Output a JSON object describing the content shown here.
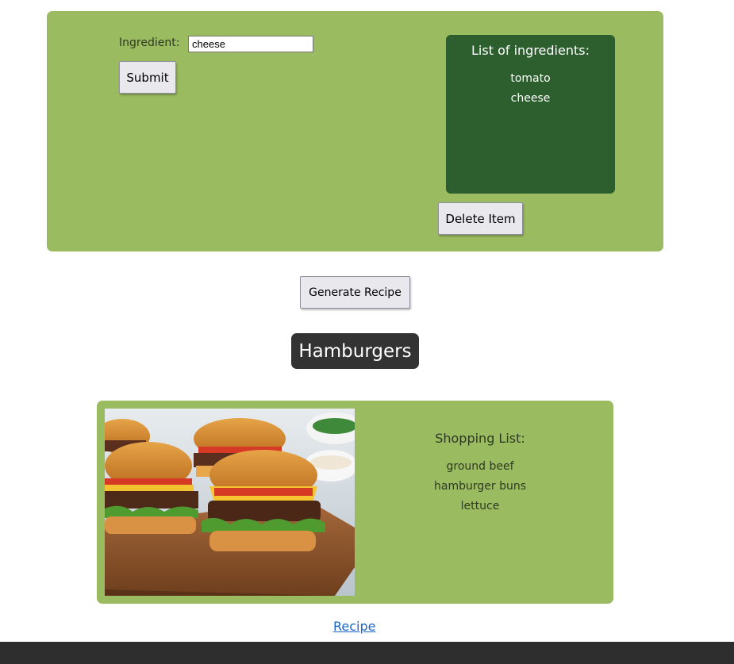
{
  "form": {
    "ingredient_label": "Ingredient:",
    "ingredient_value": "cheese",
    "submit_label": "Submit",
    "delete_label": "Delete Item"
  },
  "ingredient_list": {
    "title": "List of ingredients:",
    "items": [
      "tomato",
      "cheese"
    ]
  },
  "generate_label": "Generate Recipe",
  "recipe": {
    "title": "Hamburgers",
    "image_icon": "hamburger-photo",
    "shopping_title": "Shopping List:",
    "shopping_items": [
      "ground beef",
      "hamburger buns",
      "lettuce"
    ],
    "link_label": "Recipe"
  },
  "colors": {
    "panel": "#9bbb61",
    "list_box": "#2c5f2d",
    "title_bg": "#333333",
    "footer": "#2e2e2e",
    "link": "#1a66c8"
  }
}
